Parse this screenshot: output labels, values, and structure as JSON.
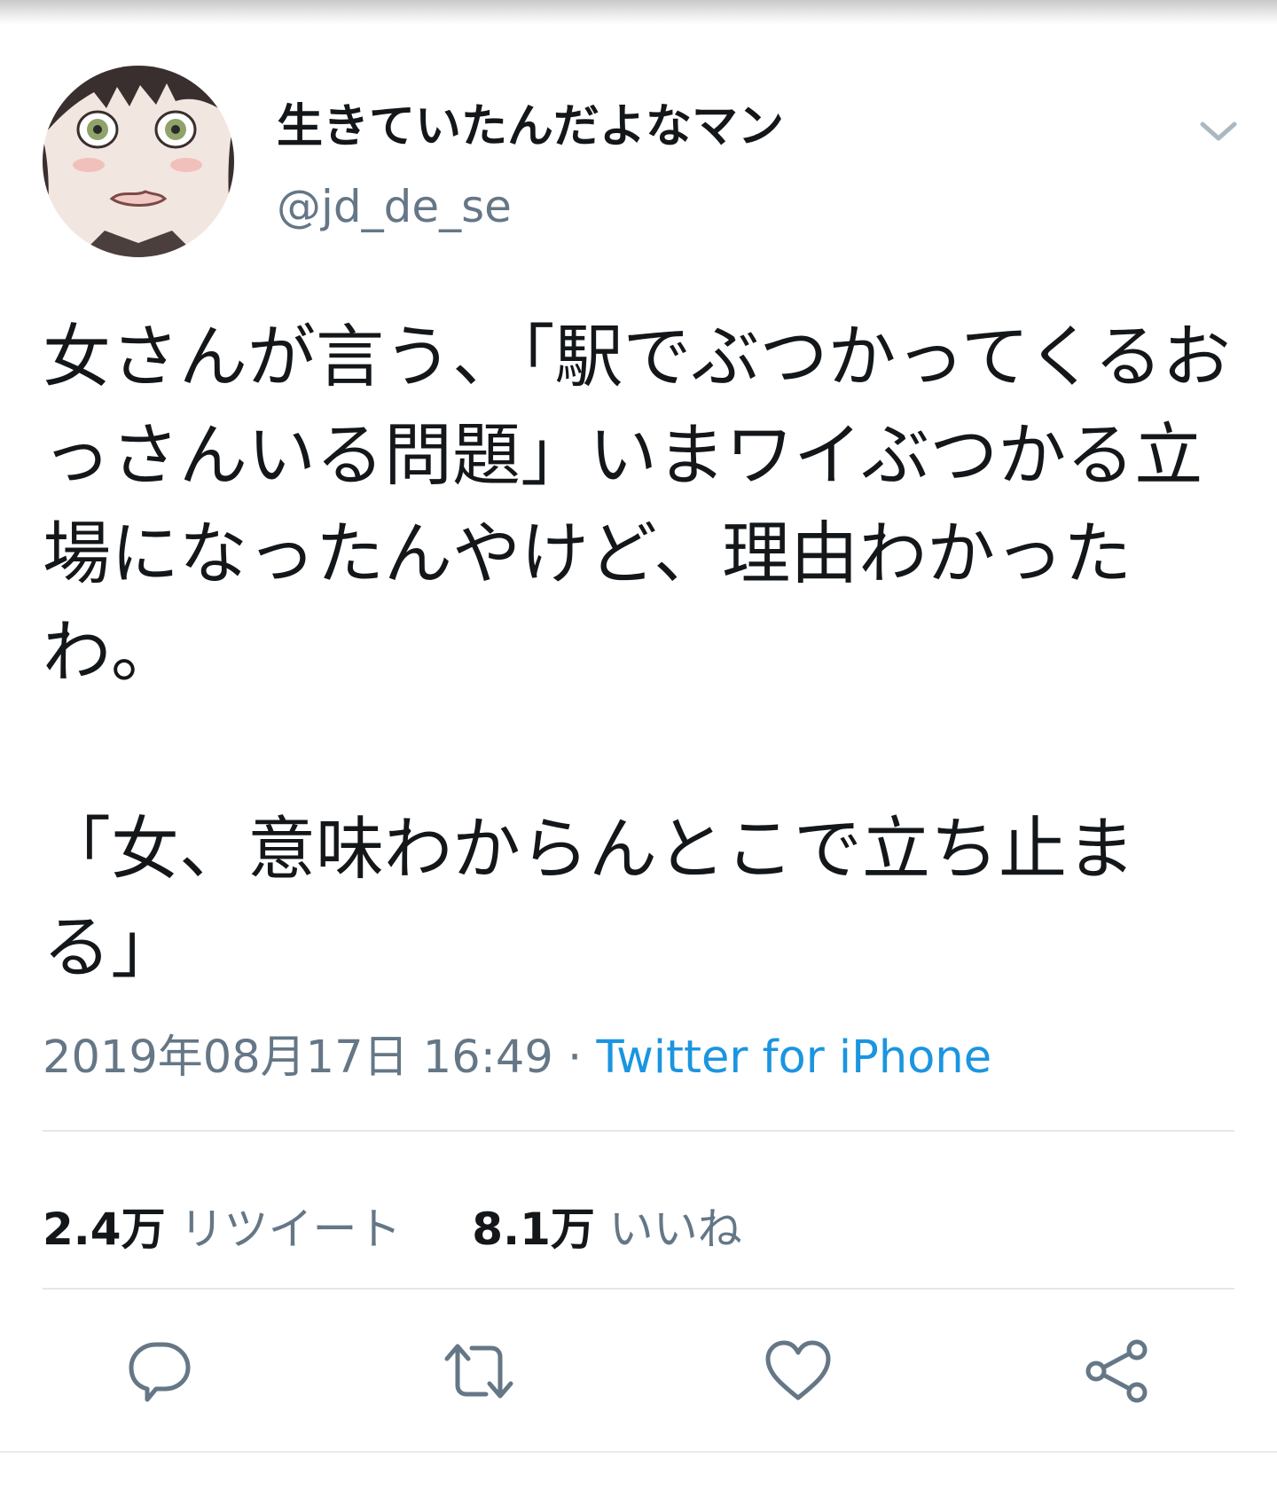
{
  "user": {
    "display_name": "生きていたんだよなマン",
    "handle": "@jd_de_se"
  },
  "tweet": {
    "text": "女さんが言う、「駅でぶつかってくるおっさんいる問題」いまワイぶつかる立場になったんやけど、理由わかったわ。\n\n「女、意味わからんとこで立ち止まる」",
    "timestamp": "2019年08月17日 16:49",
    "separator": "·",
    "source": "Twitter for iPhone"
  },
  "stats": {
    "retweets_count": "2.4万",
    "retweets_label": "リツイート",
    "likes_count": "8.1万",
    "likes_label": "いいね"
  },
  "icons": {
    "caret": "chevron-down-icon",
    "reply": "reply-icon",
    "retweet": "retweet-icon",
    "like": "heart-icon",
    "share": "share-icon"
  },
  "colors": {
    "text": "#14171a",
    "secondary": "#657786",
    "link": "#1b95e0",
    "divider": "#e1e8ed"
  }
}
